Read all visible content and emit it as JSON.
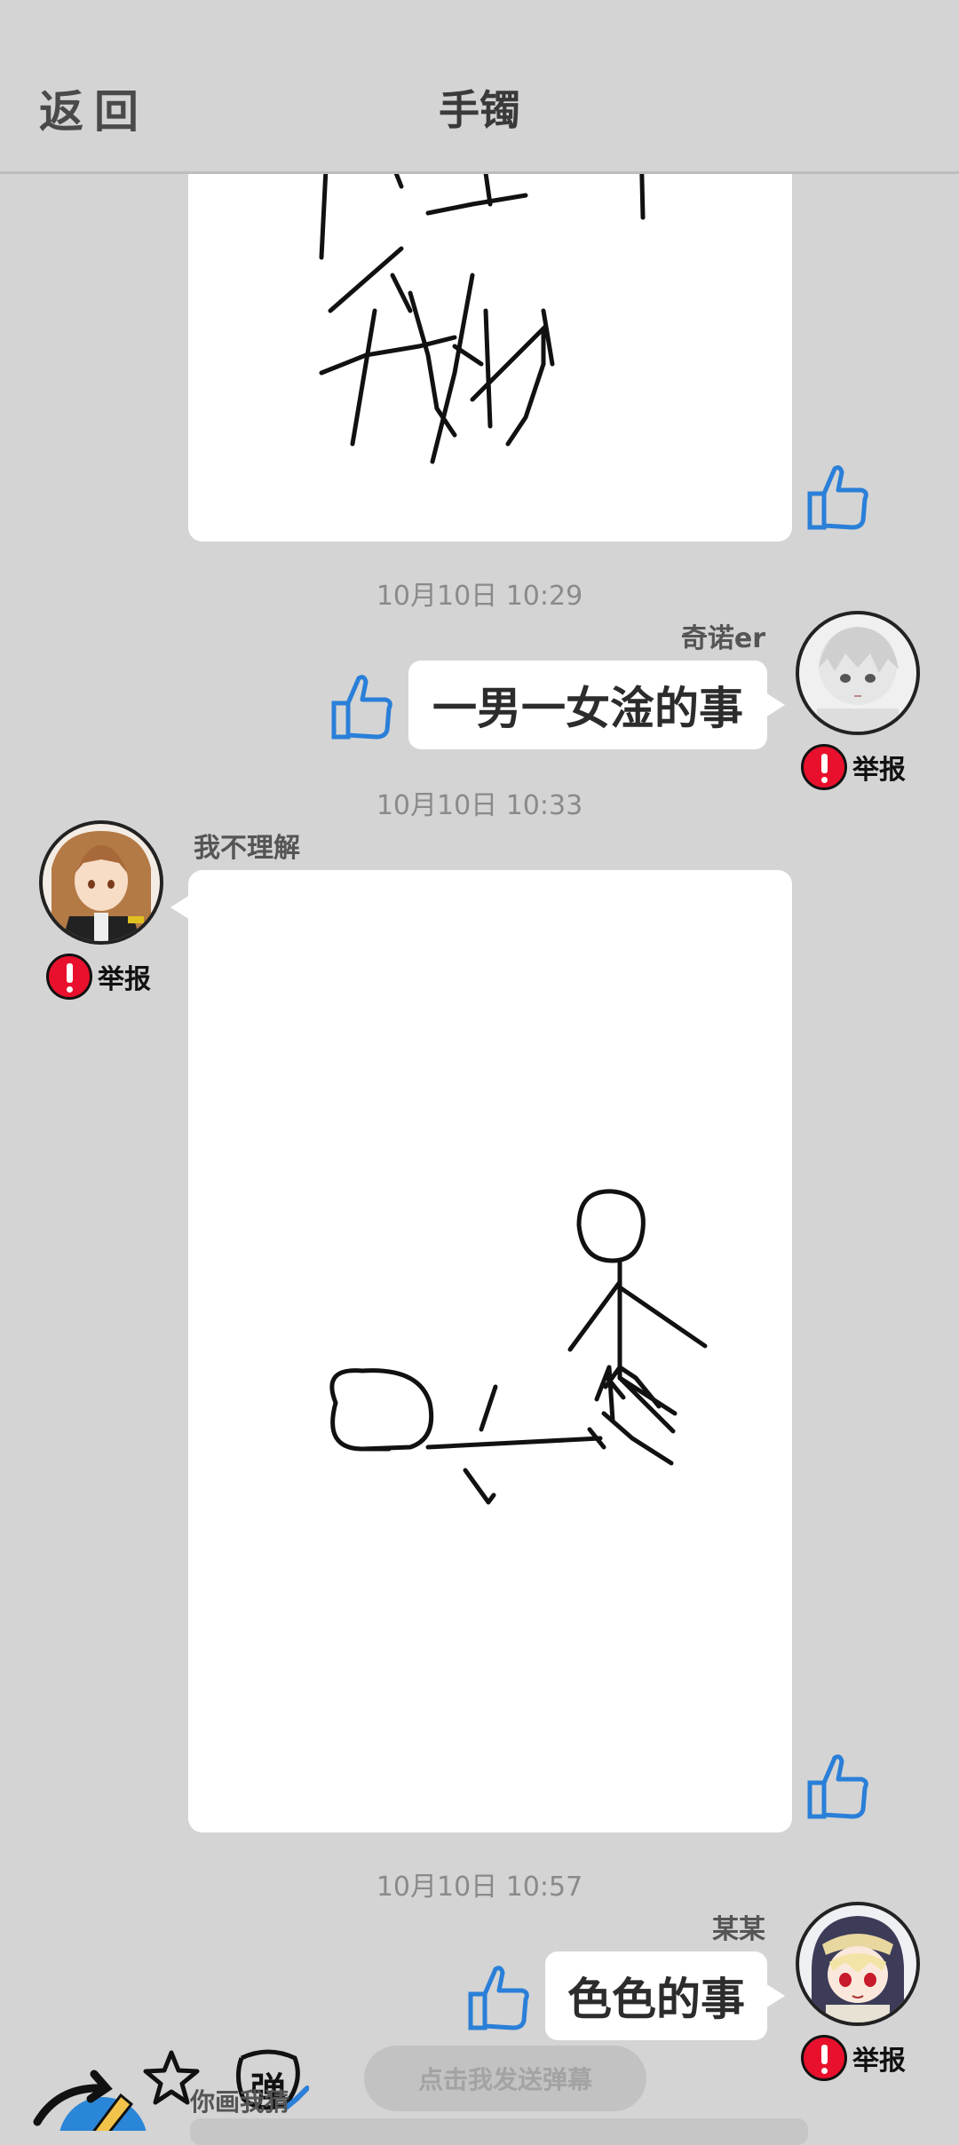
{
  "header": {
    "back_label": "返回",
    "title": "手镯"
  },
  "messages": [
    {
      "type": "drawing",
      "side": "left",
      "timestamp": ""
    },
    {
      "timestamp": "10月10日  10:29",
      "user": "奇诺er",
      "side": "right",
      "text": "一男一女淦的事",
      "report_label": "举报"
    },
    {
      "timestamp": "10月10日  10:33",
      "user": "我不理解",
      "side": "left",
      "type": "drawing",
      "report_label": "举报"
    },
    {
      "timestamp": "10月10日  10:57",
      "user": "某某",
      "side": "right",
      "text": "色色的事",
      "report_label": "举报"
    }
  ],
  "bottom": {
    "danmu_button": "点击我发送弹幕",
    "input_hint": "你画我猜",
    "danmu_toggle_char": "弹"
  },
  "icons": [
    "back-arrow-icon",
    "thumbs-up-icon",
    "report-icon",
    "star-icon",
    "share-arrow-icon",
    "danmu-toggle-icon",
    "pencil-icon"
  ],
  "colors": {
    "background": "#d4d4d4",
    "like_blue": "#2a7fd8",
    "report_red": "#e8102c"
  }
}
